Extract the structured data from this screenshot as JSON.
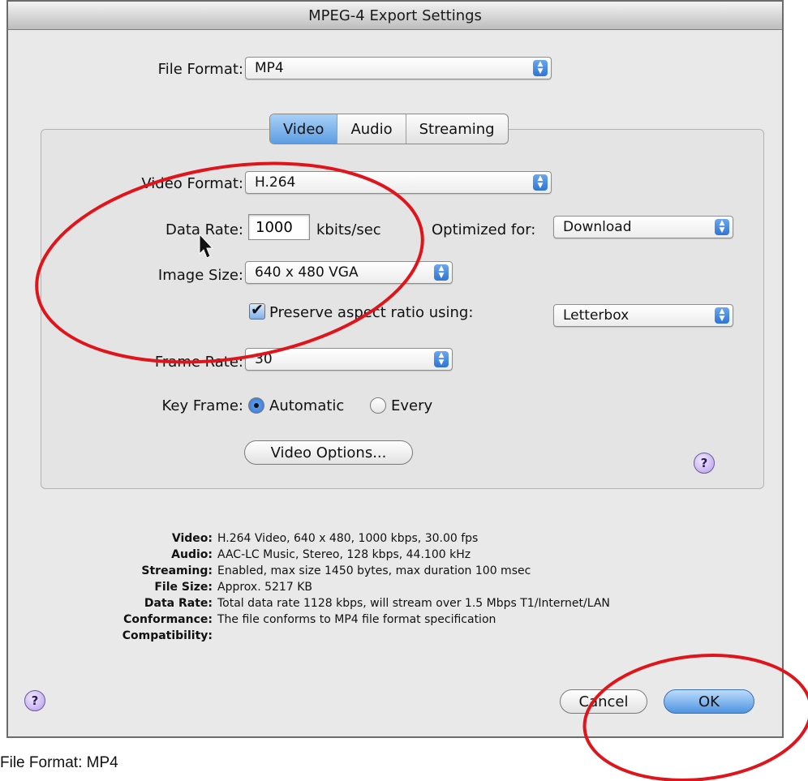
{
  "window": {
    "title": "MPEG-4 Export Settings"
  },
  "file_format": {
    "label": "File Format:",
    "value": "MP4"
  },
  "tabs": [
    {
      "label": "Video",
      "selected": true
    },
    {
      "label": "Audio",
      "selected": false
    },
    {
      "label": "Streaming",
      "selected": false
    }
  ],
  "video": {
    "format_label": "Video Format:",
    "format_value": "H.264",
    "data_rate_label": "Data Rate:",
    "data_rate_value": "1000",
    "data_rate_unit": "kbits/sec",
    "optimized_label": "Optimized for:",
    "optimized_value": "Download",
    "image_size_label": "Image Size:",
    "image_size_value": "640 x 480 VGA",
    "preserve_label": "Preserve aspect ratio using:",
    "preserve_checked": true,
    "preserve_value": "Letterbox",
    "frame_rate_label": "Frame Rate:",
    "frame_rate_value": "30",
    "key_frame_label": "Key Frame:",
    "key_frame_auto": "Automatic",
    "key_frame_every": "Every",
    "options_button": "Video Options..."
  },
  "summary": [
    {
      "key": "Video:",
      "value": "H.264 Video, 640 x 480, 1000 kbps, 30.00 fps"
    },
    {
      "key": "Audio:",
      "value": "AAC-LC Music, Stereo, 128 kbps, 44.100 kHz"
    },
    {
      "key": "Streaming:",
      "value": "Enabled, max size 1450 bytes, max duration 100 msec"
    },
    {
      "key": "File Size:",
      "value": "Approx. 5217 KB"
    },
    {
      "key": "Data Rate:",
      "value": "Total data rate 1128 kbps, will stream over 1.5 Mbps T1/Internet/LAN"
    },
    {
      "key": "Conformance:",
      "value": "The file conforms to MP4 file format specification"
    },
    {
      "key": "Compatibility:",
      "value": ""
    }
  ],
  "buttons": {
    "cancel": "Cancel",
    "ok": "OK"
  },
  "help_glyph": "?",
  "caption": "File Format: MP4",
  "colors": {
    "annotation_red": "#e0141b",
    "accent_blue": "#2f74d6"
  }
}
